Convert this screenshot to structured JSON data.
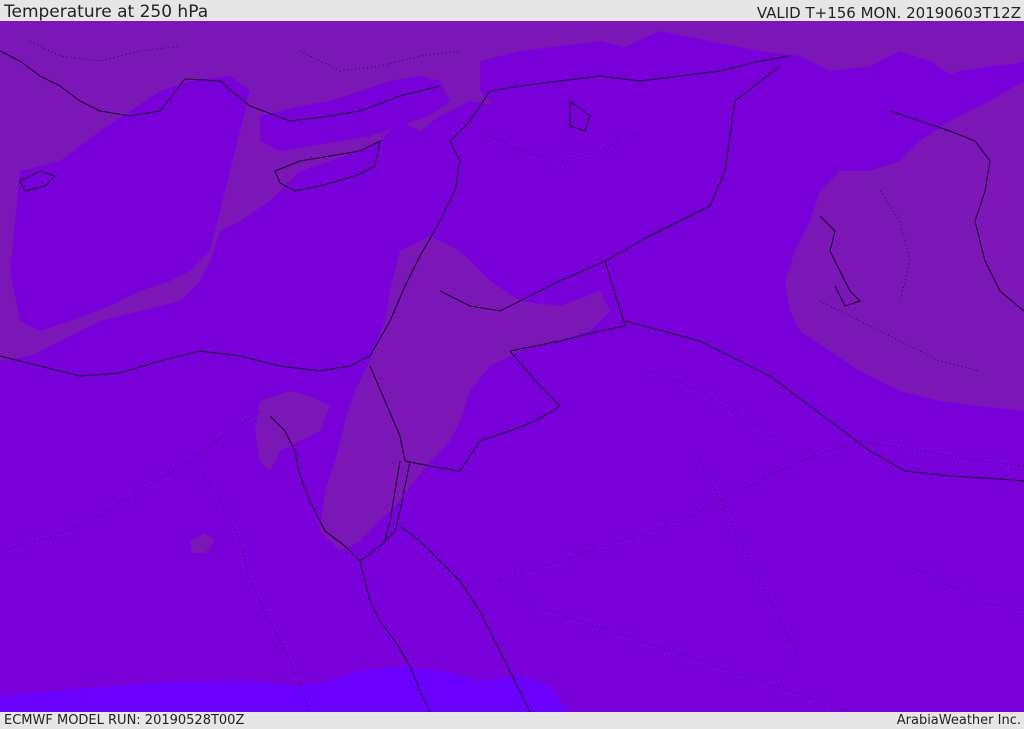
{
  "header": {
    "title": "Temperature at 250 hPa",
    "valid": "VALID T+156 MON. 20190603T12Z"
  },
  "footer": {
    "model_run": "ECMWF MODEL RUN: 20190528T00Z",
    "credit": "ArabiaWeather Inc."
  },
  "colors": {
    "field_main": "#7a00da",
    "field_cooler": "#7a17b6",
    "field_warmer": "#6c00ff",
    "coastline": "#1a0030",
    "border": "#1a0030"
  }
}
